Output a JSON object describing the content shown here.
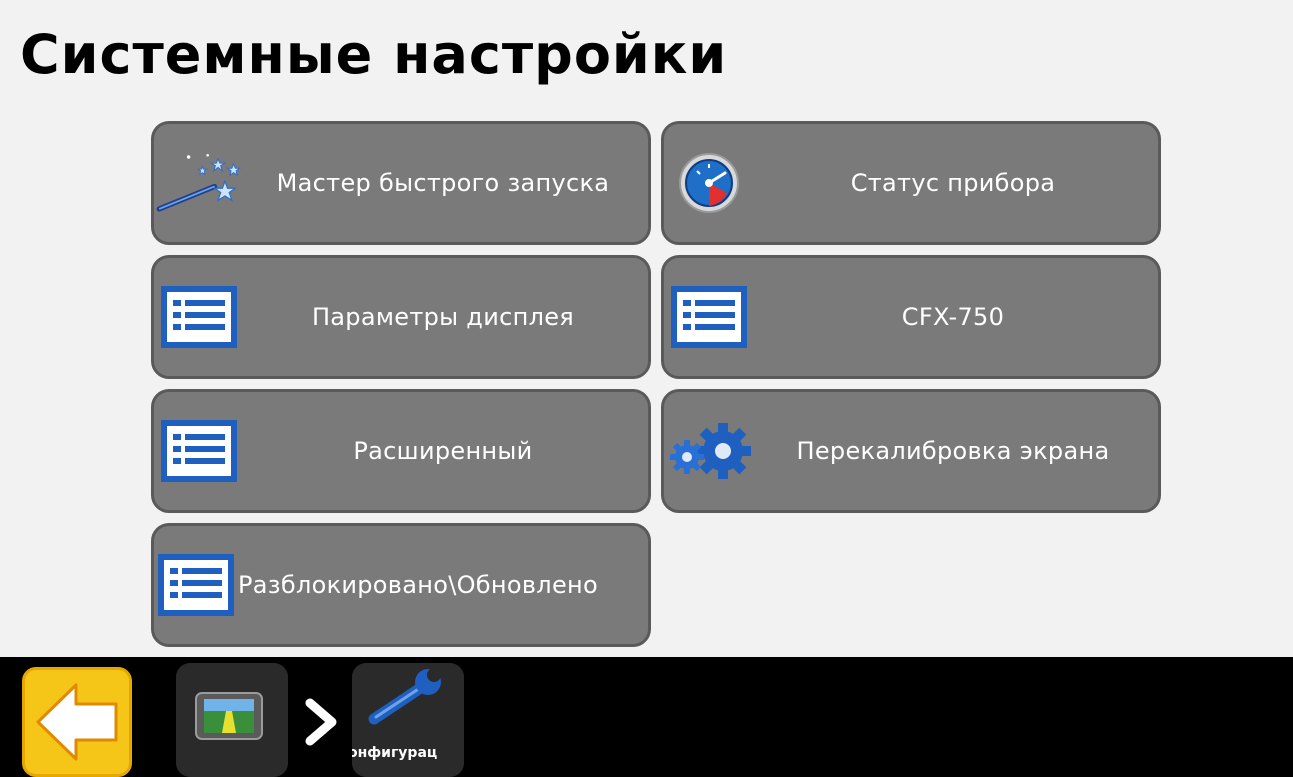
{
  "page": {
    "title": "Системные настройки"
  },
  "menu": {
    "quick_start": "Мастер быстрого запуска",
    "device_status": "Статус прибора",
    "display_params": "Параметры дисплея",
    "device_model": "CFX-750",
    "advanced": "Расширенный",
    "recalibrate": "Перекалибровка экрана",
    "unlock_update": "Разблокировано\\Обновлено"
  },
  "breadcrumb": {
    "current_label": "онфигурац"
  },
  "colors": {
    "button_bg": "#7a7a7a",
    "back_button": "#f5c518",
    "icon_blue": "#1f6fc9"
  }
}
